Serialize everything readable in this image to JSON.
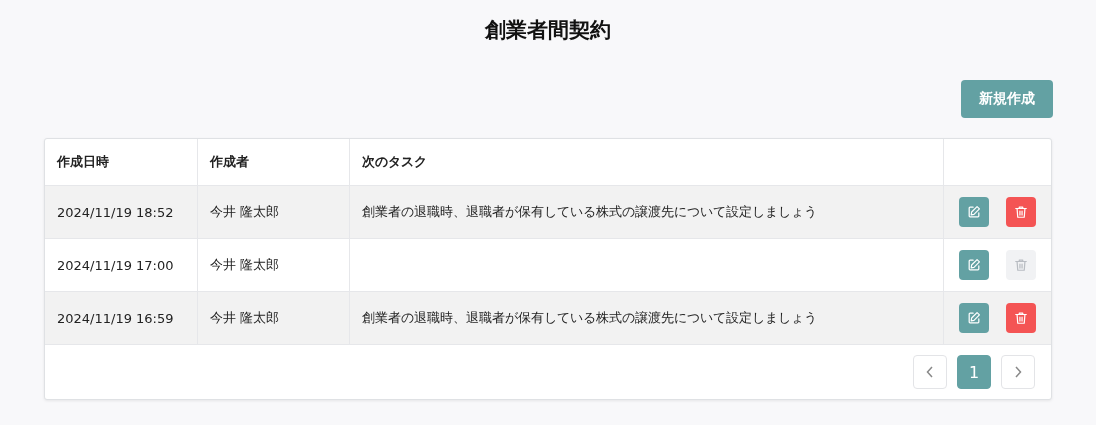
{
  "title": "創業者間契約",
  "new_button": "新規作成",
  "table": {
    "columns": [
      "作成日時",
      "作成者",
      "次のタスク"
    ],
    "rows": [
      {
        "date": "2024/11/19 18:52",
        "author": "今井 隆太郎",
        "task": "創業者の退職時、退職者が保有している株式の譲渡先について設定しましょう",
        "delete_disabled": false
      },
      {
        "date": "2024/11/19 17:00",
        "author": "今井 隆太郎",
        "delete_disabled": true
      },
      {
        "date": "2024/11/19 16:59",
        "author": "今井 隆太郎",
        "task": "創業者の退職時、退職者が保有している株式の譲渡先について設定しましょう",
        "delete_disabled": false
      }
    ]
  },
  "pagination": {
    "pages": [
      {
        "label": "1",
        "selected": true
      }
    ]
  }
}
